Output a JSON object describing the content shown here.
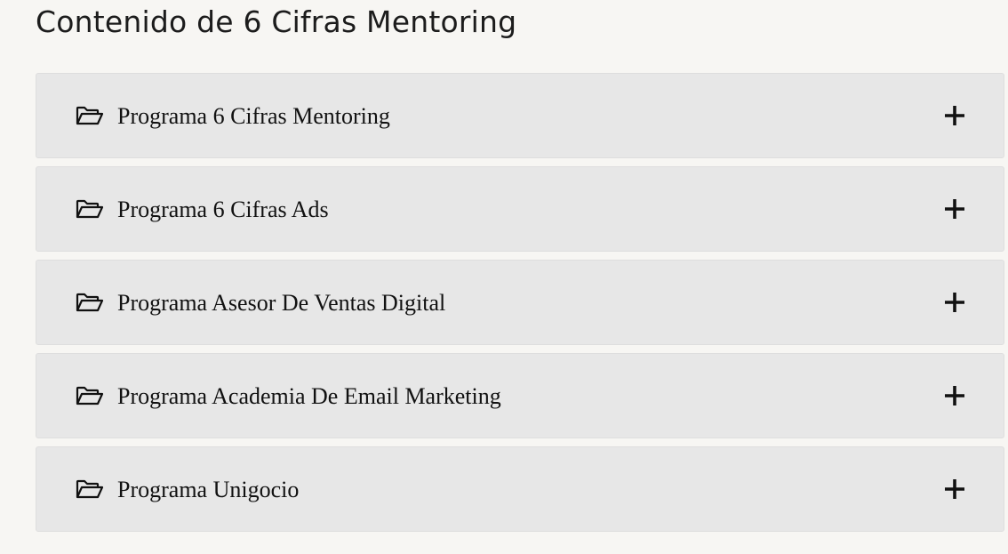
{
  "page": {
    "title": "Contenido de 6 Cifras Mentoring"
  },
  "accordion": {
    "items": [
      {
        "label": "Programa 6 Cifras Mentoring",
        "icon": "folder-open-icon",
        "toggle_icon": "plus-icon",
        "expanded": false
      },
      {
        "label": "Programa 6 Cifras Ads",
        "icon": "folder-open-icon",
        "toggle_icon": "plus-icon",
        "expanded": false
      },
      {
        "label": "Programa Asesor De Ventas Digital",
        "icon": "folder-open-icon",
        "toggle_icon": "plus-icon",
        "expanded": false
      },
      {
        "label": "Programa Academia De Email Marketing",
        "icon": "folder-open-icon",
        "toggle_icon": "plus-icon",
        "expanded": false
      },
      {
        "label": "Programa Unigocio",
        "icon": "folder-open-icon",
        "toggle_icon": "plus-icon",
        "expanded": false
      }
    ]
  },
  "colors": {
    "background": "#f7f6f3",
    "item_background": "#e7e7e7",
    "text": "#111111"
  }
}
